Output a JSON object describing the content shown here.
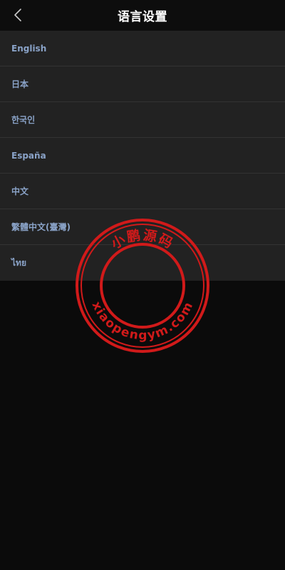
{
  "header": {
    "title": "语言设置",
    "back_icon": "chevron-left-icon"
  },
  "languages": [
    {
      "label": "English"
    },
    {
      "label": "日本"
    },
    {
      "label": "한국인"
    },
    {
      "label": "España"
    },
    {
      "label": "中文"
    },
    {
      "label": "繁體中文(臺灣)"
    },
    {
      "label": "ไทย"
    }
  ],
  "watermark": {
    "top_text": "小鹏源码",
    "bottom_text": "xiaopengym.com",
    "color": "#d11a1a"
  },
  "colors": {
    "background": "#0b0b0b",
    "list_background": "#222222",
    "label": "#8aa3c8",
    "divider": "#333333"
  }
}
